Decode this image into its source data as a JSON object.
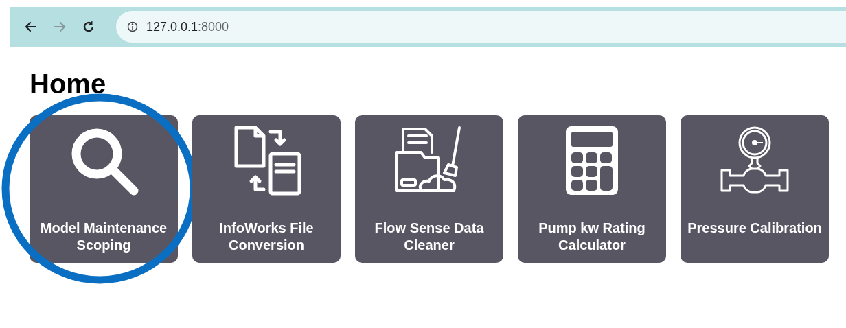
{
  "browser": {
    "url_host": "127.0.0.1",
    "url_port": ":8000",
    "forward_disabled": true
  },
  "page": {
    "title": "Home"
  },
  "cards": [
    {
      "kind": "search",
      "label": "Model Maintenance Scoping",
      "circled": true
    },
    {
      "kind": "convert",
      "label": "InfoWorks File Conversion",
      "circled": false
    },
    {
      "kind": "cleaner",
      "label": "Flow Sense Data Cleaner",
      "circled": false
    },
    {
      "kind": "calculator",
      "label": "Pump kw Rating Calculator",
      "circled": false
    },
    {
      "kind": "gauge",
      "label": "Pressure Calibration",
      "circled": false
    }
  ]
}
